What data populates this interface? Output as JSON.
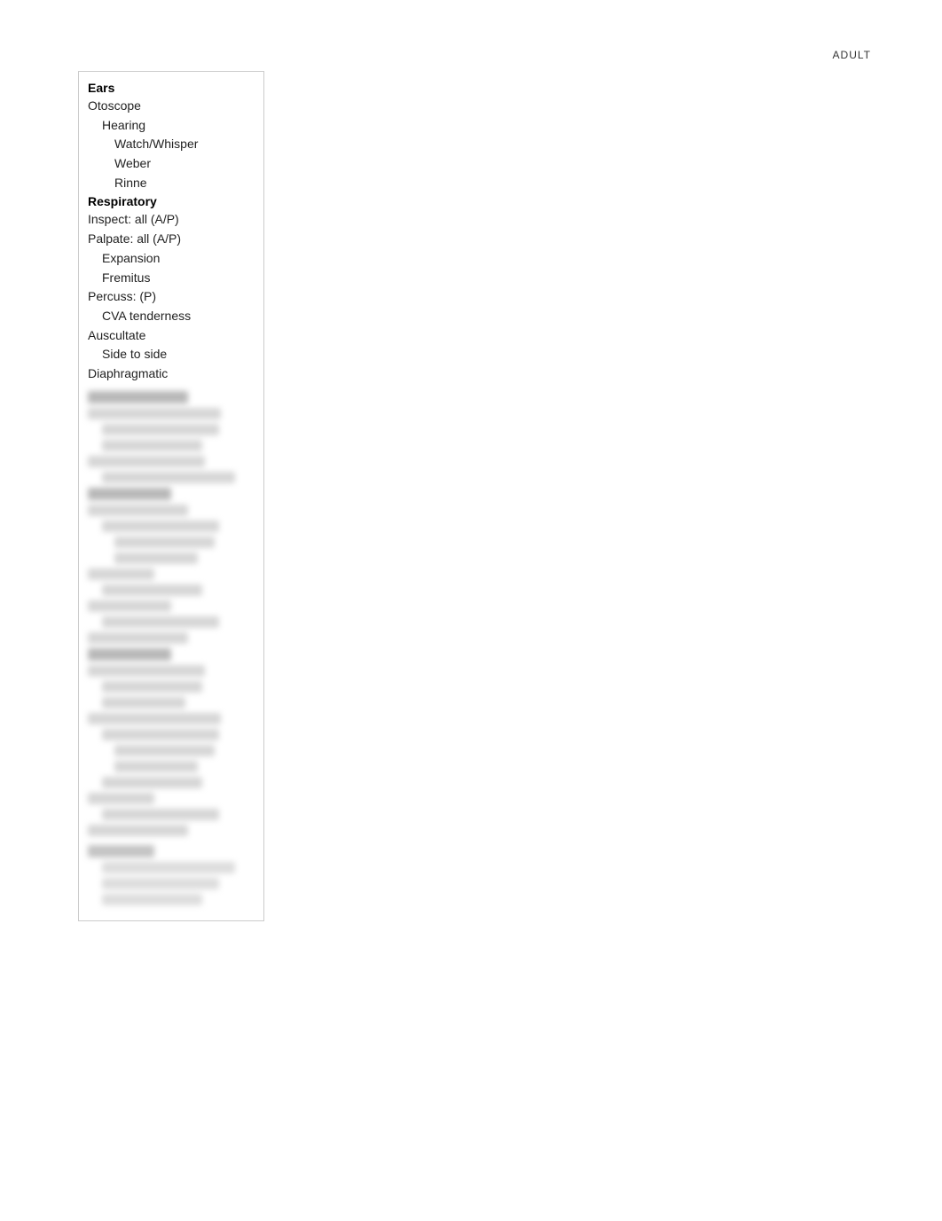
{
  "header": {
    "adult_label": "ADULT"
  },
  "panel": {
    "ears_section": {
      "header": "Ears",
      "items": [
        {
          "label": "Otoscope",
          "level": 0
        },
        {
          "label": "Hearing",
          "level": 1
        },
        {
          "label": "Watch/Whisper",
          "level": 2
        },
        {
          "label": "Weber",
          "level": 2
        },
        {
          "label": "Rinne",
          "level": 2
        }
      ]
    },
    "respiratory_section": {
      "header": "Respiratory",
      "items": [
        {
          "label": "Inspect: all (A/P)",
          "level": 0
        },
        {
          "label": "Palpate: all (A/P)",
          "level": 0
        },
        {
          "label": "Expansion",
          "level": 1
        },
        {
          "label": "Fremitus",
          "level": 1
        },
        {
          "label": "Percuss: (P)",
          "level": 0
        },
        {
          "label": "CVA tenderness",
          "level": 1
        },
        {
          "label": "Auscultate",
          "level": 0
        },
        {
          "label": "Side to side",
          "level": 1
        },
        {
          "label": "Diaphragmatic",
          "level": 0
        }
      ]
    }
  }
}
